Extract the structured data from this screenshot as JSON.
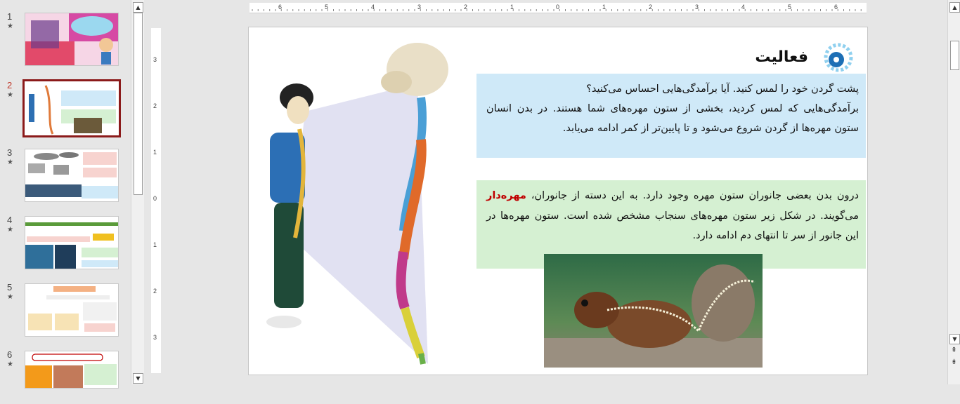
{
  "thumbnails": [
    {
      "number": "1",
      "star": "★"
    },
    {
      "number": "2",
      "star": "★"
    },
    {
      "number": "3",
      "star": "★"
    },
    {
      "number": "4",
      "star": "★"
    },
    {
      "number": "5",
      "star": "★"
    },
    {
      "number": "6",
      "star": "★"
    }
  ],
  "ruler": {
    "horizontal": [
      "6",
      "5",
      "4",
      "3",
      "2",
      "1",
      "0",
      "1",
      "2",
      "3",
      "4",
      "5",
      "6"
    ],
    "vertical": [
      "3",
      "2",
      "1",
      "0",
      "1",
      "2",
      "3"
    ]
  },
  "slide": {
    "title": "فعالیت",
    "box1": {
      "line1": "پشت گردن خود را لمس کنید. آیا برآمدگی‌هایی احساس می‌کنید؟",
      "line2": "برآمدگی‌هایی که لمس کردید، بخشی از ستون مهره‌های شما هستند. در بدن انسان ستون مهره‌ها از گردن شروع می‌شود و تا پایین‌تر از کمر ادامه می‌یابد."
    },
    "box2": {
      "before": "درون بدن بعضی جانوران ستون مهره وجود دارد. به این دسته از جانوران، ",
      "highlight": "مهره‌دار",
      "after": " می‌گویند. در شکل زیر ستون مهره‌های سنجاب مشخص شده است. ستون مهره‌ها در این جانور از سر تا انتهای دم ادامه دارد."
    }
  },
  "colors": {
    "box1_bg": "#cfe9f8",
    "box2_bg": "#d5f0d2",
    "highlight": "#c00000",
    "selected_thumb_border": "#8b1a1a"
  }
}
